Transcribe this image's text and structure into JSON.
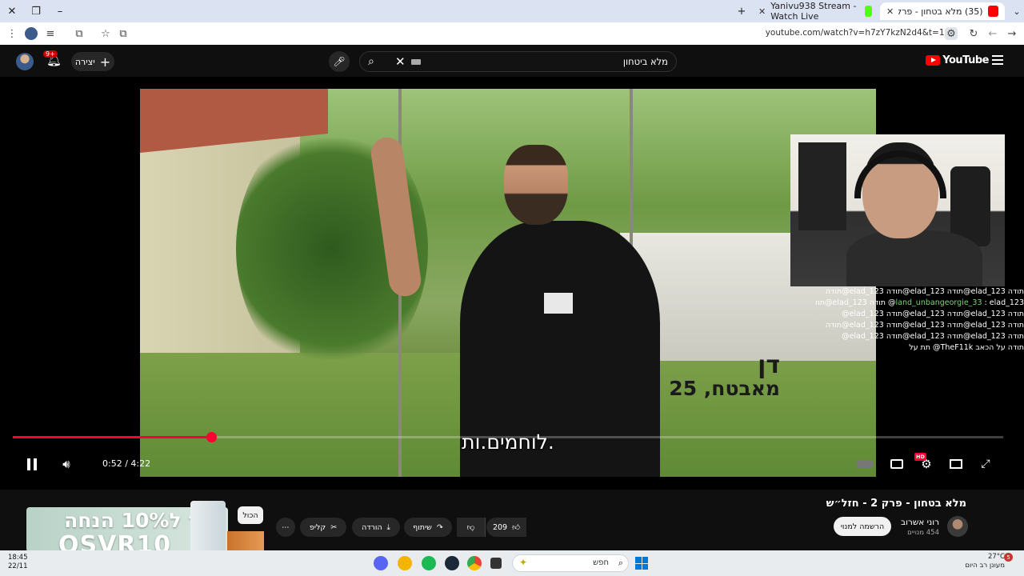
{
  "browser": {
    "tabs": [
      {
        "title": "(35) מלא בטחון - פרק 2 - ח",
        "active": true
      },
      {
        "title": "Yanivu938 Stream - Watch Live",
        "active": false
      }
    ],
    "url": "youtube.com/watch?v=h7zY7kzN2d4&t=1s",
    "new_tab": "+",
    "close_x": "✕"
  },
  "youtube": {
    "create_label": "יצירה",
    "notifications_badge": "9+",
    "search_query": "מלא ביטחון",
    "logo_text": "YouTube"
  },
  "video": {
    "overlay_name": "דן",
    "overlay_detail": "מאבטח, 25",
    "subtitle": "לוחמים.ות.",
    "time_current": "0:52",
    "time_total": "4:22",
    "time_display": "0:52 / 4:22",
    "progress_fraction": 0.2,
    "hd_badge": "HD"
  },
  "chat": [
    {
      "user": "",
      "text": "תודה elad_123@תודה elad_123@תודה 123_elad@תודה"
    },
    {
      "user": "land_unbangeorgie_33",
      "text": ": elad_123@ תודה 123_elad@תודה"
    },
    {
      "user": "",
      "text": "תודה 123_elad@תודה elad_123@תודה 123_elad@"
    },
    {
      "user": "",
      "text": "תודה 123_elad@תודה elad_123@תודה 123_elad@תודה"
    },
    {
      "user": "",
      "text": "תודה 123_elad@תודה elad_123@תודה 123_elad@"
    },
    {
      "user": "",
      "text": "תודה על הכאב TheF11k@ תת על"
    }
  ],
  "below": {
    "title": "מלא בטחון - פרק 2 - חזל״ש",
    "channel_name": "רוני אשרוב",
    "channel_subs": "454 מנויים",
    "subscribe_label": "הרשמה למנוי",
    "like_count": "209",
    "share_label": "שיתוף",
    "download_label": "הורדה",
    "clip_label": "קליפ",
    "more_label": "⋯",
    "all_chip": "הכול"
  },
  "ad": {
    "line1": "קוד ל10% הנחה",
    "line2": "OSVR10"
  },
  "taskbar": {
    "time": "18:45",
    "date": "22/11",
    "search_label": "חפש",
    "weather_temp": "27°C",
    "weather_desc": "מעונן רב היום",
    "weather_badge": "5"
  }
}
